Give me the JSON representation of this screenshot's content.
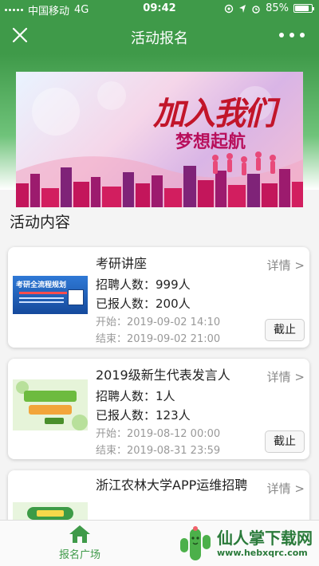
{
  "status": {
    "carrier": "中国移动",
    "network": "4G",
    "time": "09:42",
    "battery": "85%",
    "battery_level": 0.85
  },
  "nav": {
    "title": "活动报名"
  },
  "section_title": "活动内容",
  "activities": [
    {
      "name": "考研讲座",
      "detail_label": "详情 >",
      "quota_label": "招聘人数：999人",
      "enrolled_label": "已报人数：200人",
      "start_label": "开始：2019-09-02 14:10",
      "end_label": "结束：2019-09-02 21:00",
      "status_button": "截止",
      "thumb_text": "考研全流程规划"
    },
    {
      "name": "2019级新生代表发言人",
      "detail_label": "详情 >",
      "quota_label": "招聘人数：1人",
      "enrolled_label": "已报人数：123人",
      "start_label": "开始：2019-08-12 00:00",
      "end_label": "结束：2019-08-31 23:59",
      "status_button": "截止"
    },
    {
      "name": "浙江农林大学APP运维招聘",
      "detail_label": "详情 >"
    }
  ],
  "tabbar": {
    "home_label": "报名广场"
  },
  "watermark": {
    "name": "仙人掌下载网",
    "url": "www.hebxqrc.com"
  },
  "colors": {
    "brand_green": "#3f9a49"
  }
}
